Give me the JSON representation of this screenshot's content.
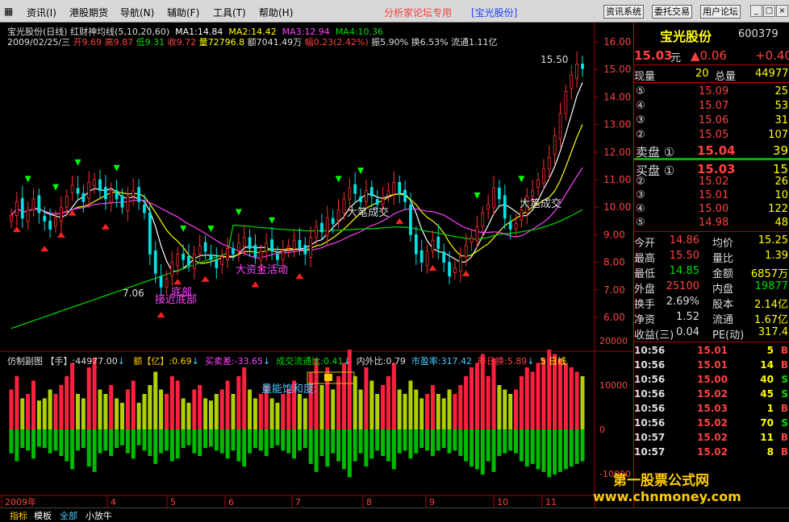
{
  "menu": [
    "资讯(I)",
    "港股期货",
    "导航(N)",
    "辅助(F)",
    "工具(T)",
    "帮助(H)"
  ],
  "forum_text": "分析家论坛专用",
  "stock_bracket": "[宝光股份]",
  "topbuttons": [
    "资讯系统",
    "委托交易",
    "用户论坛"
  ],
  "winbtns": [
    "_",
    "□",
    "×"
  ],
  "header": {
    "title": "宝光股份(日线) 红财神均线(5,10,20,60)",
    "ma1": "MA1:14.84",
    "ma2": "MA2:14.42",
    "ma3": "MA3:12.94",
    "ma4": "MA4:10.36"
  },
  "info": {
    "date": "2009/02/25/三",
    "open": "开9.69",
    "high": "高9.87",
    "low": "低9.31",
    "close": "收9.72",
    "vol": "量72796.8",
    "amt": "额7041.49万",
    "chg": "幅0.23(2.42%)",
    "amp": "振5.90%",
    "turn": "换6.53%",
    "float": "流通1.11亿"
  },
  "sub": {
    "title": "仿制副图",
    "shou": "【手】:44977.00",
    "yi": "额【亿】:0.69",
    "mmc": "买卖差:-33.65",
    "cjl": "成交流通比:0.41",
    "nwb": "内外比:0.79",
    "syl": "市盈率:317.42",
    "zrh": "昨日换:5.89",
    "days": "5 日线"
  },
  "price_axis": [
    "16.00",
    "15.00",
    "14.00",
    "13.00",
    "12.00",
    "11.00",
    "10.00",
    "9.00",
    "8.00",
    "7.00",
    "6.00"
  ],
  "vol_axis": [
    "20000",
    "10000",
    "0",
    "-10000"
  ],
  "months": [
    "2009年",
    "4",
    "5",
    "6",
    "7",
    "8",
    "9",
    "10",
    "11"
  ],
  "annotations": {
    "high": "15.50",
    "low": "7.06",
    "dibu": "底部",
    "jiejin": "接近底部",
    "dazijin": "大资金活动",
    "dabi1": "大笔成交",
    "dabi2": "大笔成交",
    "baohe": "量能饱和度:"
  },
  "right": {
    "name": "宝光股份",
    "code": "600379",
    "price": "15.03",
    "price_unit": "元",
    "chg": "▲0.06",
    "chg2": "+0.40",
    "xianpan_l": "现量",
    "xianpan_v": "20",
    "zongliang_l": "总量",
    "zongliang_v": "44977",
    "sell": [
      {
        "n": "⑤",
        "p": "15.09",
        "v": "25"
      },
      {
        "n": "④",
        "p": "15.07",
        "v": "53"
      },
      {
        "n": "③",
        "p": "15.06",
        "v": "31"
      },
      {
        "n": "②",
        "p": "15.05",
        "v": "107"
      },
      {
        "n": "卖盘 ①",
        "p": "15.04",
        "v": "39"
      }
    ],
    "buy": [
      {
        "n": "买盘 ①",
        "p": "15.03",
        "v": "15"
      },
      {
        "n": "②",
        "p": "15.02",
        "v": "26"
      },
      {
        "n": "③",
        "p": "15.01",
        "v": "10"
      },
      {
        "n": "④",
        "p": "15.00",
        "v": "122"
      },
      {
        "n": "⑤",
        "p": "14.98",
        "v": "48"
      }
    ],
    "stats": [
      [
        "今开",
        "14.86",
        "均价",
        "15.25"
      ],
      [
        "最高",
        "15.50",
        "量比",
        "1.39"
      ],
      [
        "最低",
        "14.85",
        "金额",
        "6857万"
      ],
      [
        "外盘",
        "25100",
        "内盘",
        "19877"
      ],
      [
        "换手",
        "2.69%",
        "股本",
        "2.14亿"
      ],
      [
        "净资",
        "1.52",
        "流通",
        "1.67亿"
      ],
      [
        "收益(三)",
        "0.04",
        "PE(动)",
        "317.4"
      ]
    ],
    "ticks": [
      [
        "10:56",
        "15.01",
        "5",
        "B"
      ],
      [
        "10:56",
        "15.01",
        "14",
        "B"
      ],
      [
        "10:56",
        "15.00",
        "40",
        "S"
      ],
      [
        "10:56",
        "15.02",
        "45",
        "S"
      ],
      [
        "10:56",
        "15.03",
        "1",
        "B"
      ],
      [
        "10:56",
        "15.02",
        "70",
        "S"
      ],
      [
        "10:57",
        "15.02",
        "11",
        "B"
      ],
      [
        "10:57",
        "15.02",
        "8",
        "B"
      ]
    ]
  },
  "watermark": {
    "cn": "第一股票公式网",
    "url": "www.chnmoney.com"
  },
  "tabs": [
    "指标",
    "模板",
    "全部",
    "小放牛"
  ],
  "chart_data": {
    "type": "candlestick",
    "ylim": [
      5.0,
      16.5
    ],
    "closes": [
      9.7,
      10.2,
      9.6,
      9.9,
      10.3,
      9.8,
      9.5,
      9.2,
      9.6,
      10.0,
      10.4,
      10.8,
      10.5,
      10.2,
      10.9,
      11.0,
      10.6,
      10.3,
      10.6,
      10.3,
      10.0,
      10.4,
      10.6,
      10.2,
      9.8,
      8.3,
      7.6,
      7.1,
      7.4,
      8.0,
      8.3,
      8.1,
      7.9,
      8.3,
      8.6,
      8.4,
      8.1,
      7.8,
      8.2,
      8.5,
      8.3,
      8.7,
      8.9,
      8.5,
      8.2,
      8.4,
      8.7,
      8.4,
      8.1,
      8.4,
      8.6,
      8.8,
      8.5,
      8.3,
      8.9,
      9.3,
      9.1,
      9.6,
      9.4,
      9.9,
      10.3,
      10.7,
      10.5,
      10.2,
      10.6,
      10.4,
      10.1,
      10.3,
      10.6,
      10.9,
      10.5,
      10.2,
      9.0,
      8.3,
      8.0,
      8.4,
      8.8,
      8.5,
      8.0,
      7.5,
      7.8,
      8.2,
      8.6,
      8.9,
      9.3,
      9.8,
      10.1,
      10.7,
      10.3,
      9.6,
      9.2,
      9.4,
      9.9,
      10.4,
      10.6,
      11.0,
      11.4,
      11.8,
      12.6,
      13.4,
      14.2,
      14.8,
      15.2,
      15.03
    ],
    "volumes": [
      9000,
      12000,
      7000,
      8000,
      11000,
      6500,
      7000,
      9000,
      8000,
      10000,
      12000,
      15000,
      8000,
      7000,
      14000,
      16000,
      9000,
      8000,
      10000,
      7000,
      6000,
      9000,
      11000,
      6000,
      8000,
      10000,
      13000,
      9000,
      8000,
      12000,
      11000,
      7000,
      6000,
      9000,
      10000,
      7000,
      6500,
      8000,
      9000,
      11000,
      8000,
      12000,
      14000,
      9000,
      7000,
      8000,
      10000,
      7000,
      6000,
      8000,
      9000,
      11000,
      8000,
      7000,
      13000,
      16000,
      10000,
      14000,
      9000,
      12000,
      15000,
      18000,
      12000,
      9000,
      14000,
      11000,
      8000,
      10000,
      12000,
      15000,
      9000,
      8000,
      11000,
      9000,
      7000,
      8000,
      10000,
      8000,
      7000,
      9000,
      8000,
      10000,
      12000,
      14000,
      15000,
      17000,
      12000,
      16000,
      10000,
      9000,
      8000,
      9000,
      12000,
      14000,
      13000,
      15000,
      16000,
      18000,
      17000,
      16000,
      15000,
      14000,
      13000,
      12000
    ]
  }
}
